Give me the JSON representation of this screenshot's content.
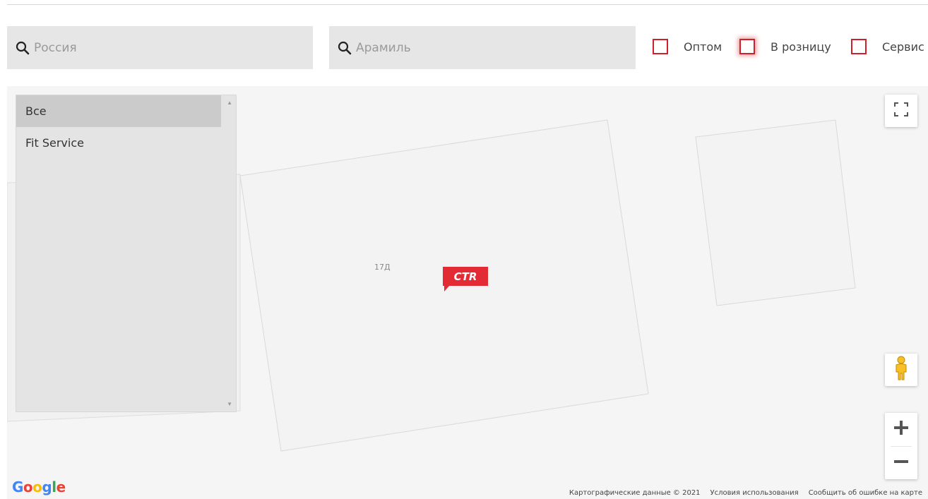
{
  "search": {
    "country_placeholder": "Россия",
    "city_placeholder": "Арамиль"
  },
  "filters": [
    {
      "label": "Оптом",
      "checked": false
    },
    {
      "label": "В розницу",
      "checked": false,
      "focused": true
    },
    {
      "label": "Сервис",
      "checked": false
    }
  ],
  "dealer_list": {
    "items": [
      "Все",
      "Fit Service"
    ],
    "selected_index": 0
  },
  "map": {
    "building_label": "17Д",
    "marker_text": "CTR",
    "marker_color": "#e32b36",
    "provider_logo": "Google",
    "footer": {
      "map_data": "Картографические данные © 2021",
      "terms": "Условия использования",
      "report": "Сообщить об ошибке на карте"
    },
    "controls": [
      "fullscreen-icon",
      "pegman-icon",
      "zoom-in-icon",
      "zoom-out-icon"
    ]
  }
}
